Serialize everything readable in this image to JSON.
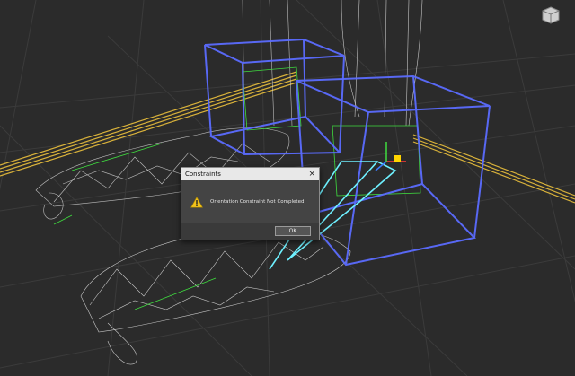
{
  "dialog": {
    "title": "Constraints",
    "close_glyph": "×",
    "message": "Orientation Constraint Not Completed",
    "ok_label": "OK",
    "icon": "warning-icon"
  },
  "viewport": {
    "background": "#2b2b2b",
    "colors": {
      "grid": "#3b3b3b",
      "bone_blue": "#5b6cff",
      "wire_white": "#d8d8d8",
      "yellow_rail": "#d9b23a",
      "cyan_link": "#6ef0ff",
      "green_helper": "#3fdc3f"
    }
  },
  "viewcube": {
    "icon": "viewcube-icon"
  }
}
